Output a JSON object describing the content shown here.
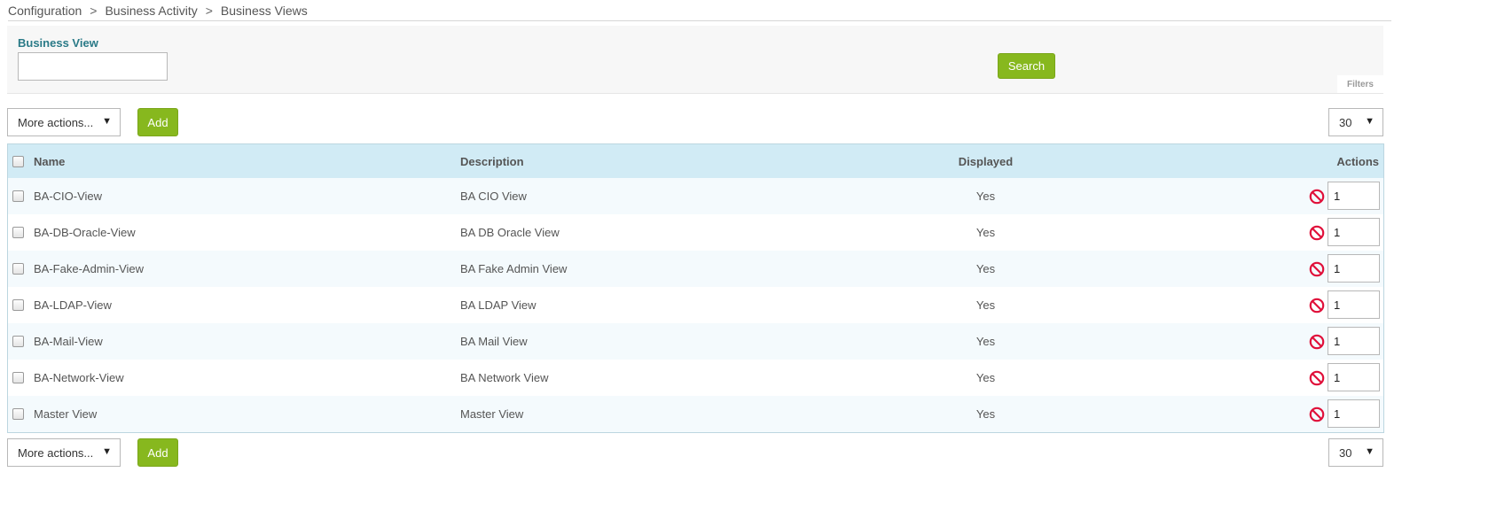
{
  "breadcrumb": {
    "items": [
      "Configuration",
      "Business Activity",
      "Business Views"
    ],
    "separator": ">"
  },
  "filters": {
    "field_label": "Business View",
    "field_value": "",
    "search_label": "Search",
    "tab_label": "Filters"
  },
  "toolbar": {
    "more_actions": "More actions...",
    "add_label": "Add",
    "page_size": "30"
  },
  "table": {
    "headers": {
      "name": "Name",
      "description": "Description",
      "displayed": "Displayed",
      "actions": "Actions"
    },
    "rows": [
      {
        "name": "BA-CIO-View",
        "description": "BA CIO View",
        "displayed": "Yes",
        "order": "1"
      },
      {
        "name": "BA-DB-Oracle-View",
        "description": "BA DB Oracle View",
        "displayed": "Yes",
        "order": "1"
      },
      {
        "name": "BA-Fake-Admin-View",
        "description": "BA Fake Admin View",
        "displayed": "Yes",
        "order": "1"
      },
      {
        "name": "BA-LDAP-View",
        "description": "BA LDAP View",
        "displayed": "Yes",
        "order": "1"
      },
      {
        "name": "BA-Mail-View",
        "description": "BA Mail View",
        "displayed": "Yes",
        "order": "1"
      },
      {
        "name": "BA-Network-View",
        "description": "BA Network View",
        "displayed": "Yes",
        "order": "1"
      },
      {
        "name": "Master View",
        "description": "Master View",
        "displayed": "Yes",
        "order": "1"
      }
    ]
  },
  "icons": {
    "disable": "forbidden-icon",
    "dropdown": "caret-down-icon"
  },
  "colors": {
    "accent_green": "#87b81e",
    "header_blue": "#d1ebf5",
    "label_teal": "#2a7a87",
    "disable_red": "#e0103a"
  }
}
